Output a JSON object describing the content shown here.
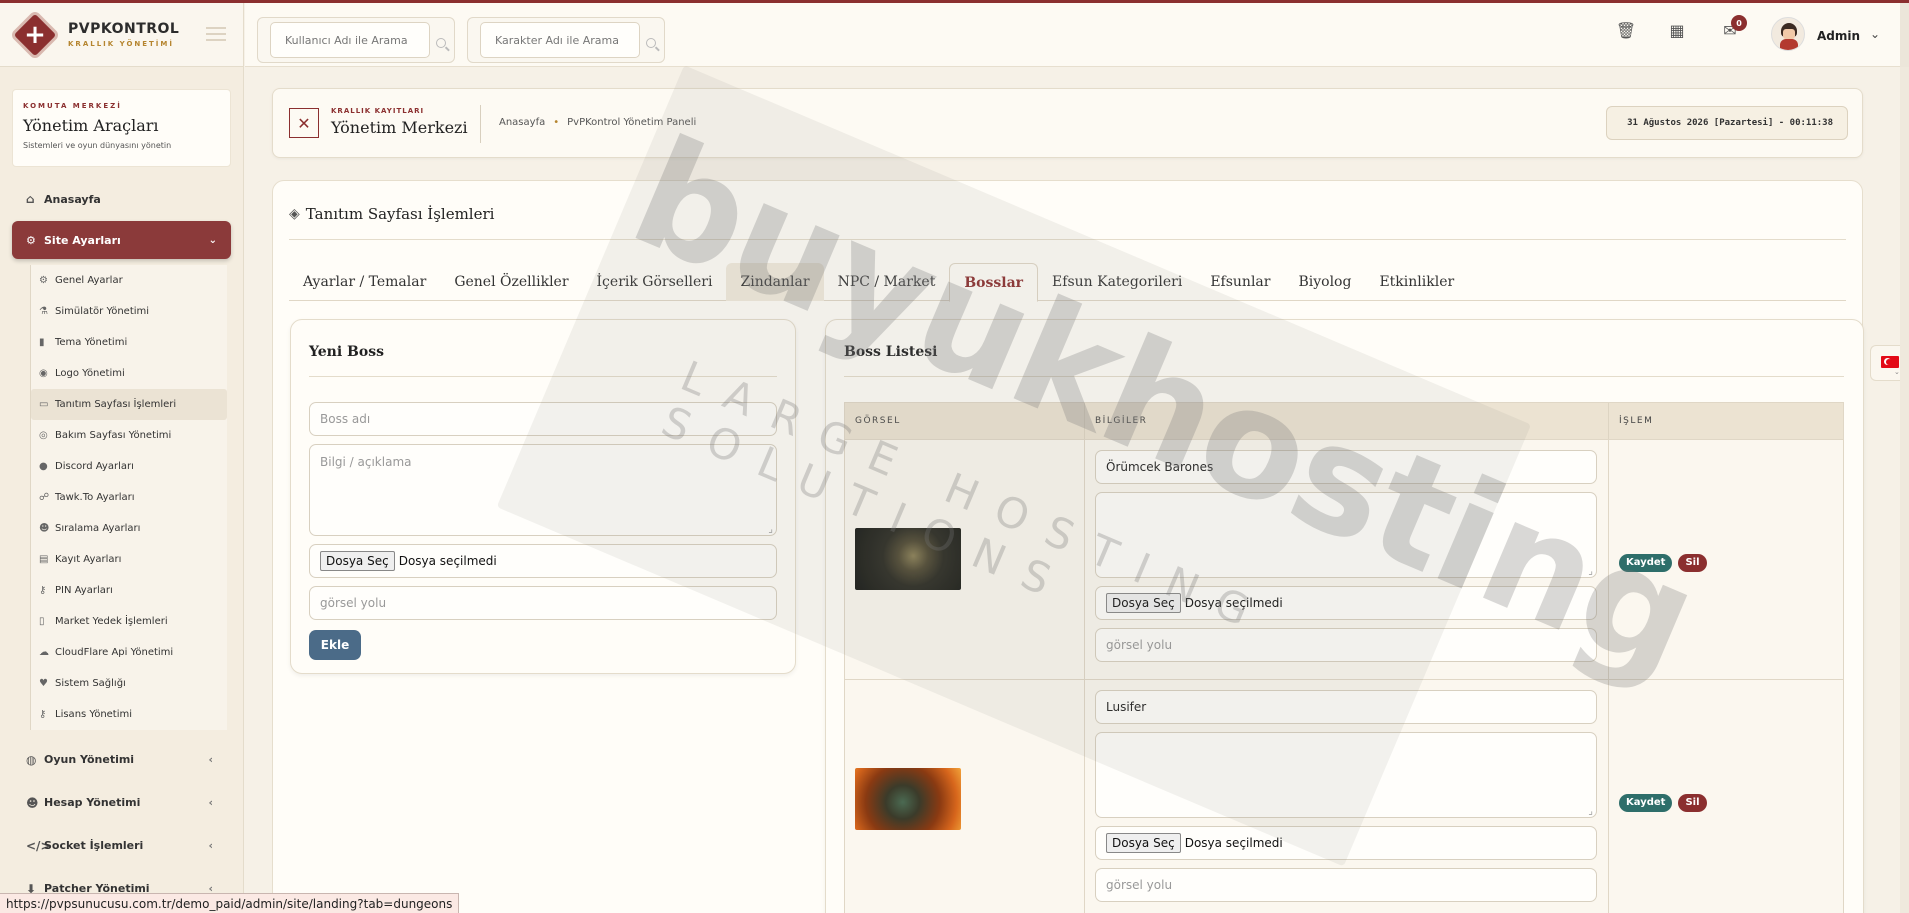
{
  "brand": {
    "title": "PVPKONTROL",
    "subtitle": "KRALLIK YÖNETİMİ"
  },
  "sidebar": {
    "card": {
      "kicker": "KOMUTA MERKEZİ",
      "title": "Yönetim Araçları",
      "subtitle": "Sistemleri ve oyun dünyasını yönetin"
    },
    "home": "Anasayfa",
    "active_group": "Site Ayarları",
    "sub_items": [
      {
        "label": "Genel Ayarlar",
        "icon": "gears-icon"
      },
      {
        "label": "Simülatör Yönetimi",
        "icon": "flask-icon"
      },
      {
        "label": "Tema Yönetimi",
        "icon": "file-icon"
      },
      {
        "label": "Logo Yönetimi",
        "icon": "eye-icon"
      },
      {
        "label": "Tanıtım Sayfası İşlemleri",
        "icon": "monitor-icon"
      },
      {
        "label": "Bakım Sayfası Yönetimi",
        "icon": "eye-slash-icon"
      },
      {
        "label": "Discord Ayarları",
        "icon": "microphone-icon"
      },
      {
        "label": "Tawk.To Ayarları",
        "icon": "handshake-icon"
      },
      {
        "label": "Sıralama Ayarları",
        "icon": "users-icon"
      },
      {
        "label": "Kayıt Ayarları",
        "icon": "id-card-icon"
      },
      {
        "label": "PIN Ayarları",
        "icon": "key-icon"
      },
      {
        "label": "Market Yedek İşlemleri",
        "icon": "doc-icon"
      },
      {
        "label": "CloudFlare Api Yönetimi",
        "icon": "cloud-icon"
      },
      {
        "label": "Sistem Sağlığı",
        "icon": "heartbeat-icon"
      },
      {
        "label": "Lisans Yönetimi",
        "icon": "key-icon"
      }
    ],
    "groups": [
      {
        "label": "Oyun Yönetimi",
        "icon": "gamepad-icon"
      },
      {
        "label": "Hesap Yönetimi",
        "icon": "users-icon"
      },
      {
        "label": "Socket İşlemleri",
        "icon": "code-icon"
      },
      {
        "label": "Patcher Yönetimi",
        "icon": "download-icon"
      }
    ]
  },
  "header": {
    "search_user_placeholder": "Kullanıcı Adı ile Arama",
    "search_char_placeholder": "Karakter Adı ile Arama",
    "notification_count": "0",
    "admin_name": "Admin"
  },
  "breadcrumb": {
    "kicker": "KRALLIK KAYITLARI",
    "title": "Yönetim Merkezi",
    "link_home": "Anasayfa",
    "link_panel": "PvPKontrol Yönetim Paneli",
    "date": "31 Ağustos 2026 [Pazartesi] - 00:11:38"
  },
  "main": {
    "title": "Tanıtım Sayfası İşlemleri",
    "tabs": [
      "Ayarlar / Temalar",
      "Genel Özellikler",
      "İçerik Görselleri",
      "Zindanlar",
      "NPC / Market",
      "Bosslar",
      "Efsun Kategorileri",
      "Efsunlar",
      "Biyolog",
      "Etkinlikler"
    ]
  },
  "new_boss": {
    "title": "Yeni Boss",
    "name_placeholder": "Boss adı",
    "desc_placeholder": "Bilgi / açıklama",
    "file_button": "Dosya Seç",
    "file_status": "Dosya seçilmedi",
    "path_placeholder": "görsel yolu",
    "add_button": "Ekle"
  },
  "boss_list": {
    "title": "Boss Listesi",
    "columns": [
      "GÖRSEL",
      "BİLGİLER",
      "İŞLEM"
    ],
    "rows": [
      {
        "name": "Örümcek Barones",
        "image": "spider-boss-image"
      },
      {
        "name": "Lusifer",
        "image": "lusifer-boss-image"
      }
    ],
    "save_label": "Kaydet",
    "delete_label": "Sil"
  },
  "watermark": {
    "main": "buyukhosting",
    "sub": "LARGE HOSTING SOLUTIONS"
  },
  "status_url": "https://pvpsunucusu.com.tr/demo_paid/admin/site/landing?tab=dungeons"
}
